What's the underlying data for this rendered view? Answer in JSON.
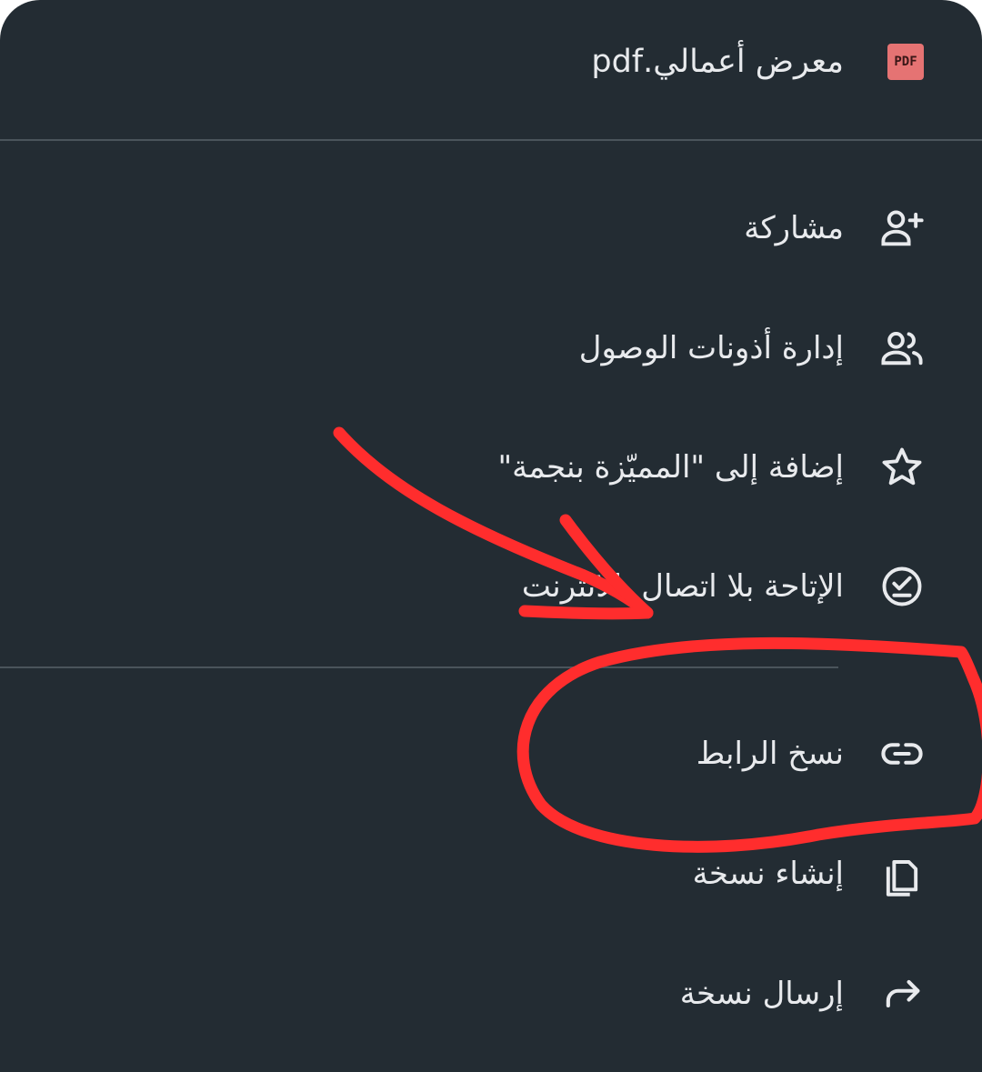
{
  "file": {
    "name": "معرض أعمالي.pdf",
    "badge": "PDF",
    "icon": "pdf-file-icon"
  },
  "menu": {
    "items": [
      {
        "label": "مشاركة",
        "icon": "person-add-icon"
      },
      {
        "label": "إدارة أذونات الوصول",
        "icon": "people-icon"
      },
      {
        "label": "إضافة إلى \"المميّزة بنجمة\"",
        "icon": "star-icon"
      },
      {
        "label": "الإتاحة بلا اتصال بالانترنت",
        "icon": "offline-check-icon"
      },
      {
        "label": "نسخ الرابط",
        "icon": "link-icon"
      },
      {
        "label": "إنشاء نسخة",
        "icon": "copy-icon"
      },
      {
        "label": "إرسال نسخة",
        "icon": "forward-icon"
      }
    ]
  },
  "colors": {
    "background": "#232c33",
    "text": "#e8eaed",
    "icon": "#e8eaed",
    "divider": "#4a545b",
    "pdf_badge": "#e57373",
    "annotation": "#ff2d2d"
  }
}
